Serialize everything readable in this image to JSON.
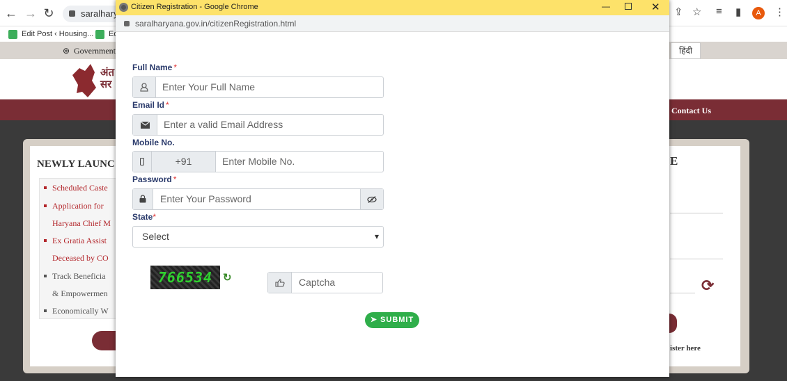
{
  "browser": {
    "url_fragment": "saralharya",
    "bookmarks": [
      "Edit Post ‹ Housing...",
      "Ed"
    ],
    "profile_initial": "A"
  },
  "site": {
    "top_strip": "Government",
    "hindi_link": "हिंदी",
    "logo_text": "अंत सर",
    "nav_contact": "Contact Us",
    "news_title": "NEWLY LAUNC",
    "news_items": [
      "Scheduled Caste",
      "Application for",
      "Haryana Chief M",
      "Ex Gratia Assist",
      "Deceased by CO",
      "Track Beneficia",
      "& Empowermen",
      "Economically W"
    ],
    "right_card_title": "E",
    "register_text": "ister here"
  },
  "popup": {
    "window_title": "Citizen Registration - Google Chrome",
    "url": "saralharyana.gov.in/citizenRegistration.html",
    "form": {
      "full_name_label": "Full Name",
      "full_name_placeholder": "Enter Your Full Name",
      "email_label": "Email Id",
      "email_placeholder": "Enter a valid Email Address",
      "mobile_label": "Mobile No.",
      "mobile_prefix": "+91",
      "mobile_placeholder": "Enter Mobile No.",
      "password_label": "Password",
      "password_placeholder": "Enter Your Password",
      "state_label": "State",
      "state_value": "Select",
      "captcha_code": "766534",
      "captcha_placeholder": "Captcha",
      "submit_label": "SUBMIT",
      "required_mark": "*"
    }
  }
}
